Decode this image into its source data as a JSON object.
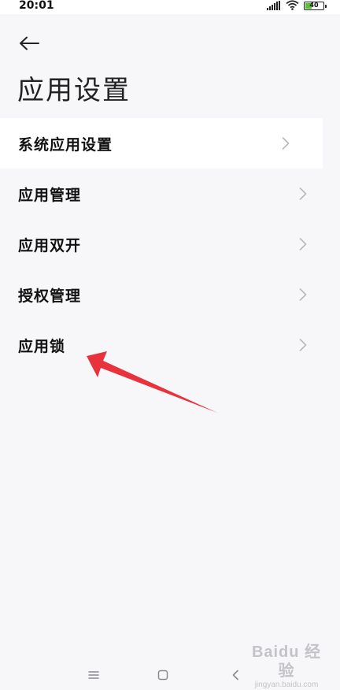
{
  "status_bar": {
    "time": "20:01",
    "battery_text": "40",
    "battery_level_percent": 40,
    "icons": [
      "signal-icon",
      "wifi-icon",
      "battery-icon"
    ]
  },
  "header": {
    "back_icon": "arrow-left-icon",
    "title": "应用设置"
  },
  "menu": {
    "items": [
      {
        "label": "系统应用设置"
      },
      {
        "label": "应用管理"
      },
      {
        "label": "应用双开"
      },
      {
        "label": "授权管理"
      },
      {
        "label": "应用锁"
      }
    ],
    "chevron_icon": "chevron-right-icon"
  },
  "annotation": {
    "arrow_color": "#e8323c"
  },
  "navigation_bar": {
    "icons": [
      "menu-icon",
      "home-icon",
      "back-icon"
    ]
  },
  "watermark": {
    "brand": "Baidu 经验",
    "url": "jingyan.baidu.com"
  },
  "colors": {
    "background": "#f7f7f9",
    "battery_fill": "#58c234",
    "chevron": "#b8b8bd",
    "watermark": "#c4c4c8"
  }
}
